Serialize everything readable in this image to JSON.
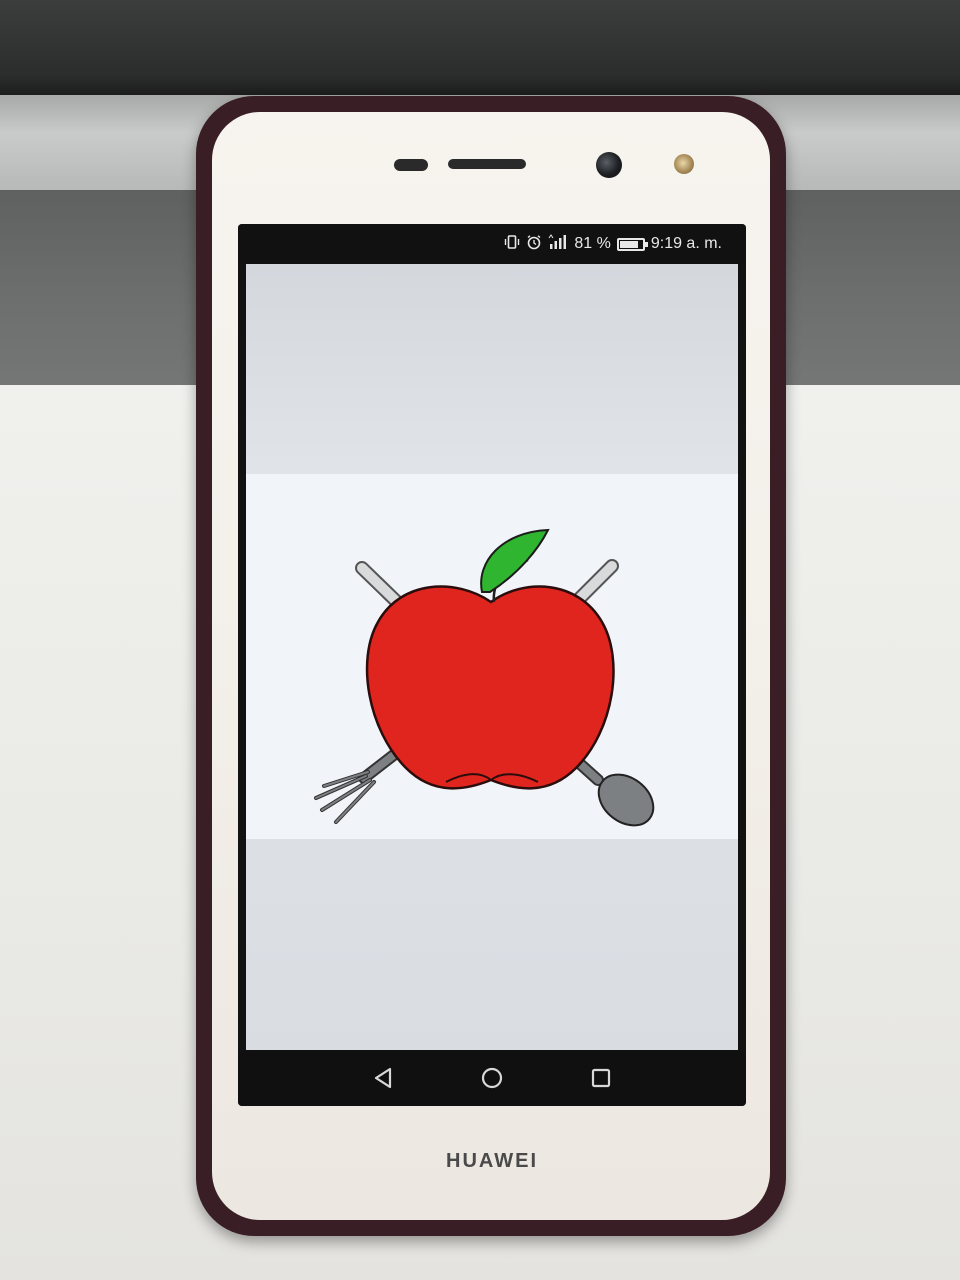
{
  "status_bar": {
    "icons": [
      "vibrate-icon",
      "alarm-icon",
      "signal-icon"
    ],
    "battery_percent": "81 %",
    "battery_level": 0.81,
    "time": "9:19 a. m."
  },
  "app": {
    "logo": "apple-with-fork-and-spoon-logo",
    "colors": {
      "apple": "#e0241e",
      "leaf": "#2fb52f",
      "utensils": "#7d8083"
    }
  },
  "nav_bar": {
    "buttons": [
      "back-icon",
      "home-icon",
      "recents-icon"
    ]
  },
  "device": {
    "brand": "HUAWEI"
  }
}
